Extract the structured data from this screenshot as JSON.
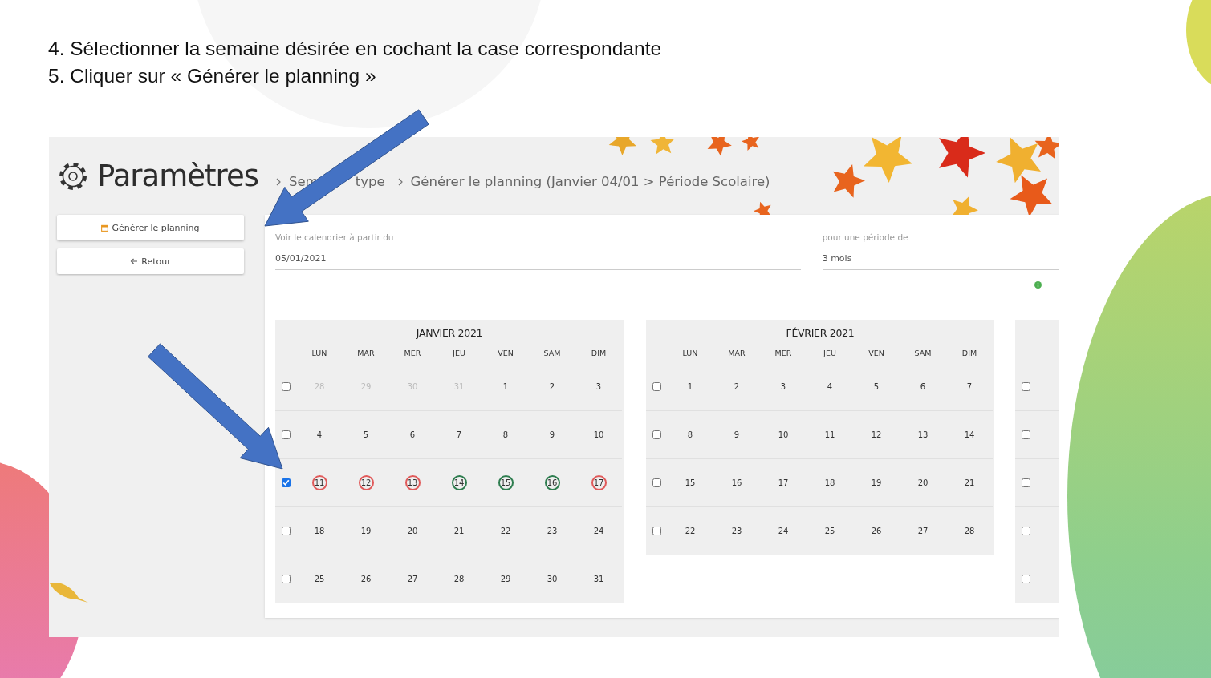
{
  "instructions": [
    "4. Sélectionner la semaine désirée en cochant la case correspondante",
    "5. Cliquer sur « Générer le planning »"
  ],
  "app": {
    "title": "Paramètres",
    "breadcrumbs": [
      {
        "parts": [
          "Sem",
          "type"
        ]
      },
      {
        "parts": [
          "Générer le planning (Janvier 04/01 > Période Scolaire)"
        ]
      }
    ],
    "sidebar_buttons": [
      {
        "label": "Générer le planning"
      },
      {
        "label": "Retour"
      }
    ],
    "fields": [
      {
        "label": "Voir le calendrier à partir du",
        "value": "05/01/2021"
      },
      {
        "label": "pour une période de",
        "value": "3 mois"
      }
    ],
    "months": [
      {
        "title": "JANVIER 2021",
        "weekdays": [
          "LUN",
          "MAR",
          "MER",
          "JEU",
          "VEN",
          "SAM",
          "DIM"
        ],
        "weeks": [
          {
            "checked": false,
            "days": [
              {
                "day": "28",
                "muted": true
              },
              {
                "day": "29",
                "muted": true
              },
              {
                "day": "30",
                "muted": true
              },
              {
                "day": "31",
                "muted": true
              },
              {
                "day": "1",
                "muted": false
              },
              {
                "day": "2",
                "muted": false
              },
              {
                "day": "3",
                "muted": false
              }
            ]
          },
          {
            "checked": false,
            "days": [
              {
                "day": "4",
                "muted": false
              },
              {
                "day": "5",
                "muted": false
              },
              {
                "day": "6",
                "muted": false
              },
              {
                "day": "7",
                "muted": false
              },
              {
                "day": "8",
                "muted": false
              },
              {
                "day": "9",
                "muted": false
              },
              {
                "day": "10",
                "muted": false
              }
            ]
          },
          {
            "checked": true,
            "days": [
              {
                "day": "11",
                "muted": false,
                "color": "#e05a5a"
              },
              {
                "day": "12",
                "muted": false,
                "color": "#e05a5a"
              },
              {
                "day": "13",
                "muted": false,
                "color": "#e05a5a"
              },
              {
                "day": "14",
                "muted": false,
                "color": "#2e7d4f"
              },
              {
                "day": "15",
                "muted": false,
                "color": "#2e7d4f"
              },
              {
                "day": "16",
                "muted": false,
                "color": "#2e7d4f"
              },
              {
                "day": "17",
                "muted": false,
                "color": "#e05a5a"
              }
            ]
          },
          {
            "checked": false,
            "days": [
              {
                "day": "18",
                "muted": false
              },
              {
                "day": "19",
                "muted": false
              },
              {
                "day": "20",
                "muted": false
              },
              {
                "day": "21",
                "muted": false
              },
              {
                "day": "22",
                "muted": false
              },
              {
                "day": "23",
                "muted": false
              },
              {
                "day": "24",
                "muted": false
              }
            ]
          },
          {
            "checked": false,
            "days": [
              {
                "day": "25",
                "muted": false
              },
              {
                "day": "26",
                "muted": false
              },
              {
                "day": "27",
                "muted": false
              },
              {
                "day": "28",
                "muted": false
              },
              {
                "day": "29",
                "muted": false
              },
              {
                "day": "30",
                "muted": false
              },
              {
                "day": "31",
                "muted": false
              }
            ]
          }
        ]
      },
      {
        "title": "FÉVRIER 2021",
        "weekdays": [
          "LUN",
          "MAR",
          "MER",
          "JEU",
          "VEN",
          "SAM",
          "DIM"
        ],
        "weeks": [
          {
            "checked": false,
            "days": [
              {
                "day": "1",
                "muted": false
              },
              {
                "day": "2",
                "muted": false
              },
              {
                "day": "3",
                "muted": false
              },
              {
                "day": "4",
                "muted": false
              },
              {
                "day": "5",
                "muted": false
              },
              {
                "day": "6",
                "muted": false
              },
              {
                "day": "7",
                "muted": false
              }
            ]
          },
          {
            "checked": false,
            "days": [
              {
                "day": "8",
                "muted": false
              },
              {
                "day": "9",
                "muted": false
              },
              {
                "day": "10",
                "muted": false
              },
              {
                "day": "11",
                "muted": false
              },
              {
                "day": "12",
                "muted": false
              },
              {
                "day": "13",
                "muted": false
              },
              {
                "day": "14",
                "muted": false
              }
            ]
          },
          {
            "checked": false,
            "days": [
              {
                "day": "15",
                "muted": false
              },
              {
                "day": "16",
                "muted": false
              },
              {
                "day": "17",
                "muted": false
              },
              {
                "day": "18",
                "muted": false
              },
              {
                "day": "19",
                "muted": false
              },
              {
                "day": "20",
                "muted": false
              },
              {
                "day": "21",
                "muted": false
              }
            ]
          },
          {
            "checked": false,
            "days": [
              {
                "day": "22",
                "muted": false
              },
              {
                "day": "23",
                "muted": false
              },
              {
                "day": "24",
                "muted": false
              },
              {
                "day": "25",
                "muted": false
              },
              {
                "day": "26",
                "muted": false
              },
              {
                "day": "27",
                "muted": false
              },
              {
                "day": "28",
                "muted": false
              }
            ]
          }
        ]
      },
      {
        "weeks": [
          {
            "checked": false
          },
          {
            "checked": false
          },
          {
            "checked": false
          },
          {
            "checked": false
          },
          {
            "checked": false
          }
        ]
      }
    ]
  }
}
